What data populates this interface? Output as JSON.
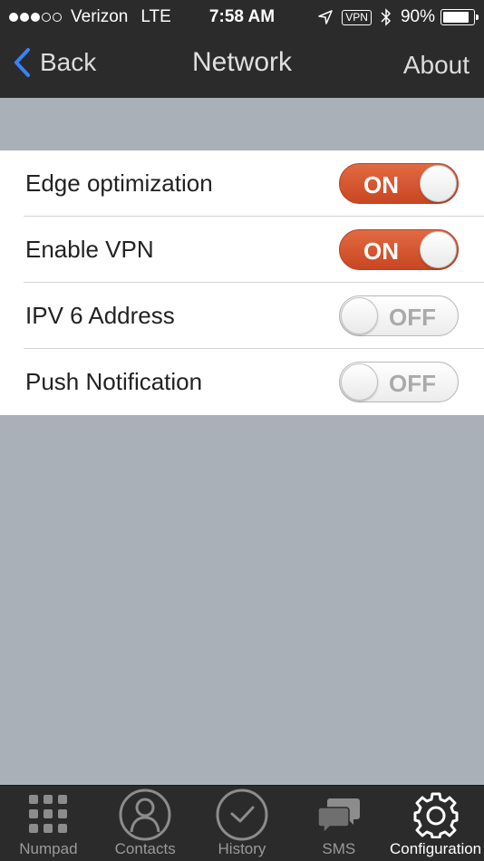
{
  "status_bar": {
    "carrier": "Verizon",
    "network": "LTE",
    "time": "7:58 AM",
    "vpn_badge": "VPN",
    "battery_percent": "90%",
    "battery_level": 0.9
  },
  "nav": {
    "back_label": "Back",
    "title": "Network",
    "about_label": "About"
  },
  "settings": [
    {
      "label": "Edge optimization",
      "state": "on",
      "state_label": "ON"
    },
    {
      "label": "Enable VPN",
      "state": "on",
      "state_label": "ON"
    },
    {
      "label": "IPV 6 Address",
      "state": "off",
      "state_label": "OFF"
    },
    {
      "label": "Push Notification",
      "state": "off",
      "state_label": "OFF"
    }
  ],
  "tabs": [
    {
      "label": "Numpad",
      "icon": "numpad-icon",
      "active": false
    },
    {
      "label": "Contacts",
      "icon": "contacts-icon",
      "active": false
    },
    {
      "label": "History",
      "icon": "clock-icon",
      "active": false
    },
    {
      "label": "SMS",
      "icon": "chat-bubbles-icon",
      "active": false
    },
    {
      "label": "Configuration",
      "icon": "gear-icon",
      "active": true
    }
  ],
  "colors": {
    "toggle_on": "#d4552f",
    "bar_background": "#2b2b2b",
    "page_background": "#a9b0b8",
    "back_chevron": "#3b82f6"
  }
}
